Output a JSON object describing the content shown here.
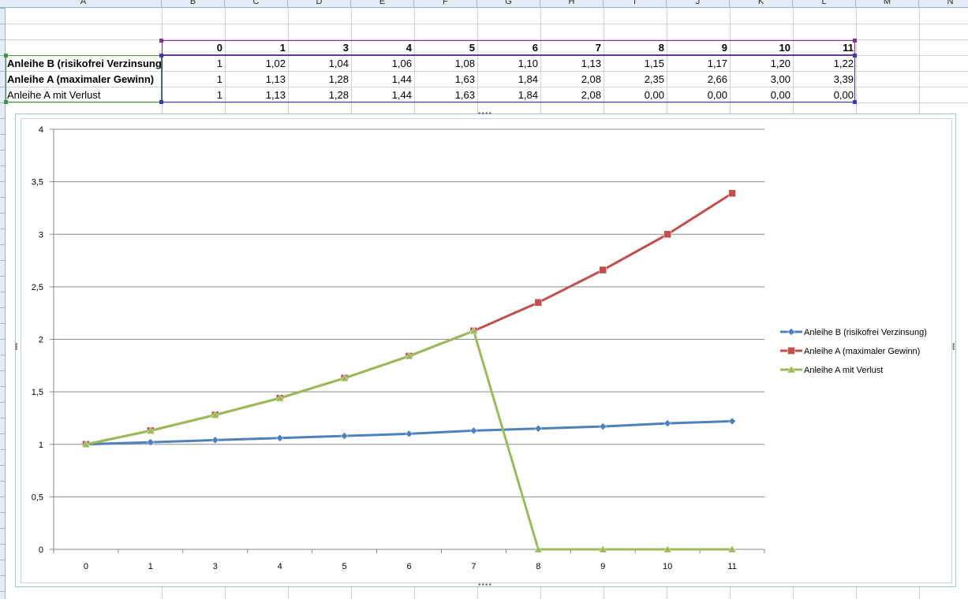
{
  "spreadsheet": {
    "column_headers": [
      "A",
      "B",
      "C",
      "D",
      "E",
      "F",
      "G",
      "H",
      "I",
      "J",
      "K",
      "L",
      "M",
      "N"
    ],
    "table": {
      "header": [
        "0",
        "1",
        "3",
        "4",
        "5",
        "6",
        "7",
        "8",
        "9",
        "10",
        "11"
      ],
      "rows": [
        {
          "label": "Anleihe B (risikofrei Verzinsung)",
          "bold": true,
          "values": [
            "1",
            "1,02",
            "1,04",
            "1,06",
            "1,08",
            "1,10",
            "1,13",
            "1,15",
            "1,17",
            "1,20",
            "1,22"
          ]
        },
        {
          "label": "Anleihe A (maximaler Gewinn)",
          "bold": true,
          "values": [
            "1",
            "1,13",
            "1,28",
            "1,44",
            "1,63",
            "1,84",
            "2,08",
            "2,35",
            "2,66",
            "3,00",
            "3,39"
          ]
        },
        {
          "label": "Anleihe A mit Verlust",
          "bold": false,
          "values": [
            "1",
            "1,13",
            "1,28",
            "1,44",
            "1,63",
            "1,84",
            "2,08",
            "0,00",
            "0,00",
            "0,00",
            "0,00"
          ]
        }
      ]
    }
  },
  "chart_data": {
    "type": "line",
    "categories": [
      "0",
      "1",
      "3",
      "4",
      "5",
      "6",
      "7",
      "8",
      "9",
      "10",
      "11"
    ],
    "series": [
      {
        "name": "Anleihe B (risikofrei Verzinsung)",
        "color": "#4f81bd",
        "marker": "diamond",
        "values": [
          1,
          1.02,
          1.04,
          1.06,
          1.08,
          1.1,
          1.13,
          1.15,
          1.17,
          1.2,
          1.22
        ]
      },
      {
        "name": "Anleihe A (maximaler Gewinn)",
        "color": "#c0504d",
        "marker": "square",
        "values": [
          1,
          1.13,
          1.28,
          1.44,
          1.63,
          1.84,
          2.08,
          2.35,
          2.66,
          3.0,
          3.39
        ]
      },
      {
        "name": "Anleihe A mit Verlust",
        "color": "#9bbb59",
        "marker": "triangle",
        "values": [
          1,
          1.13,
          1.28,
          1.44,
          1.63,
          1.84,
          2.08,
          0,
          0,
          0,
          0
        ]
      }
    ],
    "ylim": [
      0,
      4
    ],
    "yticks": [
      "0",
      "0,5",
      "1",
      "1,5",
      "2",
      "2,5",
      "3",
      "3,5",
      "4"
    ],
    "grid": "horizontal",
    "legend": "right"
  }
}
